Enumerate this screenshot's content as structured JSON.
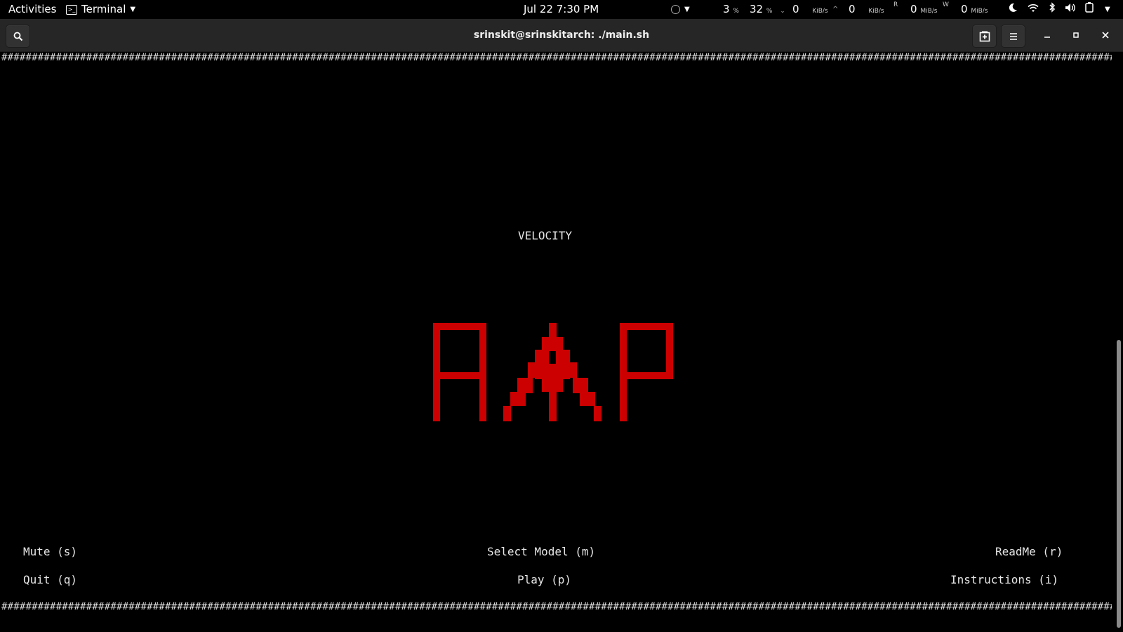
{
  "topbar": {
    "activities": "Activities",
    "app_menu": "Terminal",
    "datetime": "Jul 22  7:30 PM",
    "cpu": "3",
    "cpu_unit": "%",
    "mem": "32",
    "mem_unit": "%",
    "net_down": "0",
    "net_down_unit": "KiB/s",
    "net_up": "0",
    "net_up_unit": "KiB/s",
    "disk_read_label": "R",
    "disk_read": "0",
    "disk_read_unit": "MiB/s",
    "disk_write_label": "W",
    "disk_write": "0",
    "disk_write_unit": "MiB/s"
  },
  "window": {
    "title": "srinskit@srinskitarch: ./main.sh"
  },
  "terminal": {
    "border_char": "#",
    "game_title": "VELOCITY",
    "logo_text": "RAP",
    "logo_color": "#cc0000",
    "menu": {
      "mute": "Mute (s)",
      "select_model": "Select Model (m)",
      "readme": "ReadMe (r)",
      "quit": "Quit (q)",
      "play": "Play (p)",
      "instructions": "Instructions (i)"
    }
  }
}
